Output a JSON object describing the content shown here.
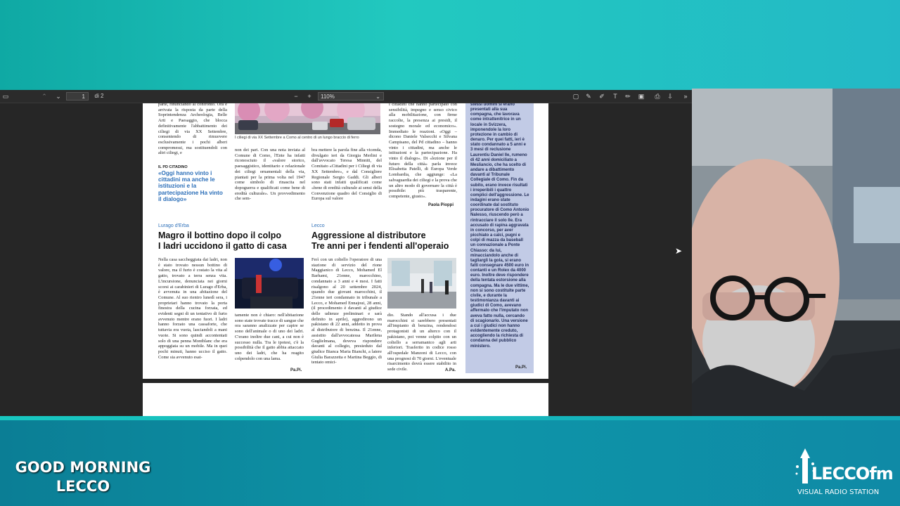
{
  "toolbar": {
    "page_current": "1",
    "page_total": "di 2",
    "zoom": "110%"
  },
  "article_top": {
    "col1": "parte, rinunciando al confronto. Ora è arrivata la risposta da parte della Soprintendenza Archeologia, Belle Arti e Paesaggio, che blocca definitivamente l'abbattimento dei ciliegi di via XX Settembre, consentendo di rimuovere esclusivamente i pochi alberi compromessi, ma sostituendoli con altri ciliegi, e",
    "photo_caption": "I ciliegi di via XX Settembre a Como al centro di un lungo braccio di ferro",
    "col2": "non dei pari. Con una nota inviata al Comune di Como, l'Ente ha infatti riconosciuto il «valore storico, paesaggistico, identitario e relazionale dei ciliegi ornamentali della via, piantati per la prima volta nel 1947 come simbolo di rinascita nel dopoguerra e qualificati come bene di eredità culturale». Un provvedimento che sem-",
    "col3": "bra mettere la parola fine alla vicenda, divulgato ieri da Giorgia Merlini e dall'avvocato Teresa Minniti, del Comitato «Cittadini per i Ciliegi di via XX Settembre», e dal Consigliere Regionale Sergio Gaddi. Gli alberi sono stati infatti qualificati come «bene di eredità culturale ai sensi della Convenzione quadro del Consiglio di Europa sul valore",
    "col4": "i cittadini che hanno partecipato con sensibilità, impegno e senso civico alla mobilitazione, con firme raccolte, la presenza ai presidi, il sostegno morale ed economico». Immediato le reazioni. «Oggi – dicono Daniele Valsecchi e Silvana Campisano, del Pd cittadino – hanno vinto i cittadini, ma anche le istituzioni e la partecipazione. Ha vinto il dialogo». Di «lezione per il futuro della città» parla invece Elisabetta Patelli, di Europa Verde Lombardia, che aggiunge: «La salvaguardia dei ciliegi e la prova che un altro modo di governare la città è possibile: più trasparente, competente, giusto».",
    "signature": "Paola Pioppi",
    "quote_label": "IL PD CITADINO",
    "quote": "«Oggi hanno vinto i cittadini ma anche le istituzioni e la partecipazione Ha vinto il dialogo»"
  },
  "article_left": {
    "section": "Lurago d'Erba",
    "headline_1": "Magro il bottino dopo il colpo",
    "headline_2": "I ladri uccidono il gatto di casa",
    "col1": "Nella casa saccheggiata dai ladri, non è stato trovato nessun bottino di valore, ma il furto è costato la vita al gatto, trovato a terra senza vita. L'incursione, denunciata nei giorni scorsi ai carabinieri di Lurago d'Erba, è avvenuta in una abitazione del Comune. Al suo rientro lunedì sera, i proprietari hanno trovato la porta finestra della cucina forzata, ed evidenti segni di un tentativo di furto avvenuto mentre erano fuori. I ladri hanno forzato una cassaforte, che tuttavia era vuota, lasciandoli a mani vuote. Si sono quindi accontentati solo di una penna Montblanc che era appoggiata su un mobile. Ma in quei pochi minuti, hanno ucciso il gatto. Come sia avvenuto esat-",
    "col2": "tamente non è chiaro: nell'abitazione sono state trovate tracce di sangue che ora saranno analizzate per capire se sono dell'animale o di uno dei ladri. C'erano inoltre due cani, a cui non è successo nulla. Tra le ipotesi, c'è la possibilità che il gatto abbia attaccato uno dei ladri, che ha reagito colpendolo con una lama.",
    "signature": "Pa.Pi."
  },
  "article_right": {
    "section": "Lecco",
    "headline_1": "Aggressione al distributore",
    "headline_2": "Tre anni per i fendenti all'operaio",
    "col1": "Ferì con un coltello l'operatore di una stazione di servizio del rione Maggianico di Lecco, Mohamed El Barhami, 21enne, marocchino, condannato a 3 anni e 4 mesi. I fatti risalgono al 20 settembre 2024, quando due giovani marocchini, il 21enne ieri condannato in tribunale a Lecco, e Mohamed Ennajoui, 28 anni, (il procedimento è davanti al giudice delle udienze preliminari e sarà definito in aprile), aggredirono un pakistano di 22 anni, addetto in prova al distributore di benzina. Il 21enne, assistito dall'avvocatessa Marilena Guglielmana, doveva rispondere davanti al collegio, presieduto dal giudice Bianca Maria Bianchi, a latere Giulia Barazzetta e Martina Beggio, di tentato omici-",
    "col2": "dio. Stando all'accusa i due marocchini si sarebbero presentati all'impianto di benzina, rendendosi protagonisti di un alterco con il pakistano, poi venne colpito con un coltello a serramanico agli arti inferiori. Trasferito in codice rosso all'ospedale Manzoni di Lecco, con una prognosi di 70 giorni. L'eventuale risarcimento dovrà essere stabilito in sede civile.",
    "signature": "A.Pa."
  },
  "sidebar": {
    "text": "stessi uomini si erano presentati alla sua compagna, che lavorava come intrattenitrice in un locale in Svizzera, imponendole la loro protezione in cambio di denaro. Per quei fatti, ieri è stato condannato a 5 anni e 3 mesi di reclusione Laurentiu Daniel Ile, rumeno di 42 anni domiciliato a Mesliancio, che ha scelto di andare a dibattimento davanti al Tribunale Collegiale di Como. Fin da subito, erano invece risultati i irreperibili i quattro complici dell'aggressione. Le indagini erano state coordinate dal sostituto procuratore di Como Antonio Nalesso, riuscendo però a rintracciare il solo Ile. Era accusato di rapina aggravata in concorso, per aver picchiato a calci, pugni e colpi di mazza da baseball un connazionale a Ponte Chiasso: da lui, minacciandolo anche di tagliargli la gola, si erano fatti consegnare 4500 euro in contanti e un Rolex da 4000 euro. Inoltre deve rispondere della tentata estorsione alla compagna. Ma le due vittime, non si sono costituite parte civile, e durante la testimonianza davanti ai giudici di Como, avevano affermato che l'imputato non aveva fatto nulla, cercando di scagionarlo. Una versione a cui i giudici non hanno evidentemente creduto, accogliendo la richiesta di condanna del pubblico ministero.",
    "signature": "Pa.Pi."
  },
  "show": {
    "title_line1": "GOOD MORNING",
    "title_line2": "LECCO"
  },
  "logo": {
    "name": "LECCOfm",
    "tag": "VISUAL RADIO STATION"
  }
}
